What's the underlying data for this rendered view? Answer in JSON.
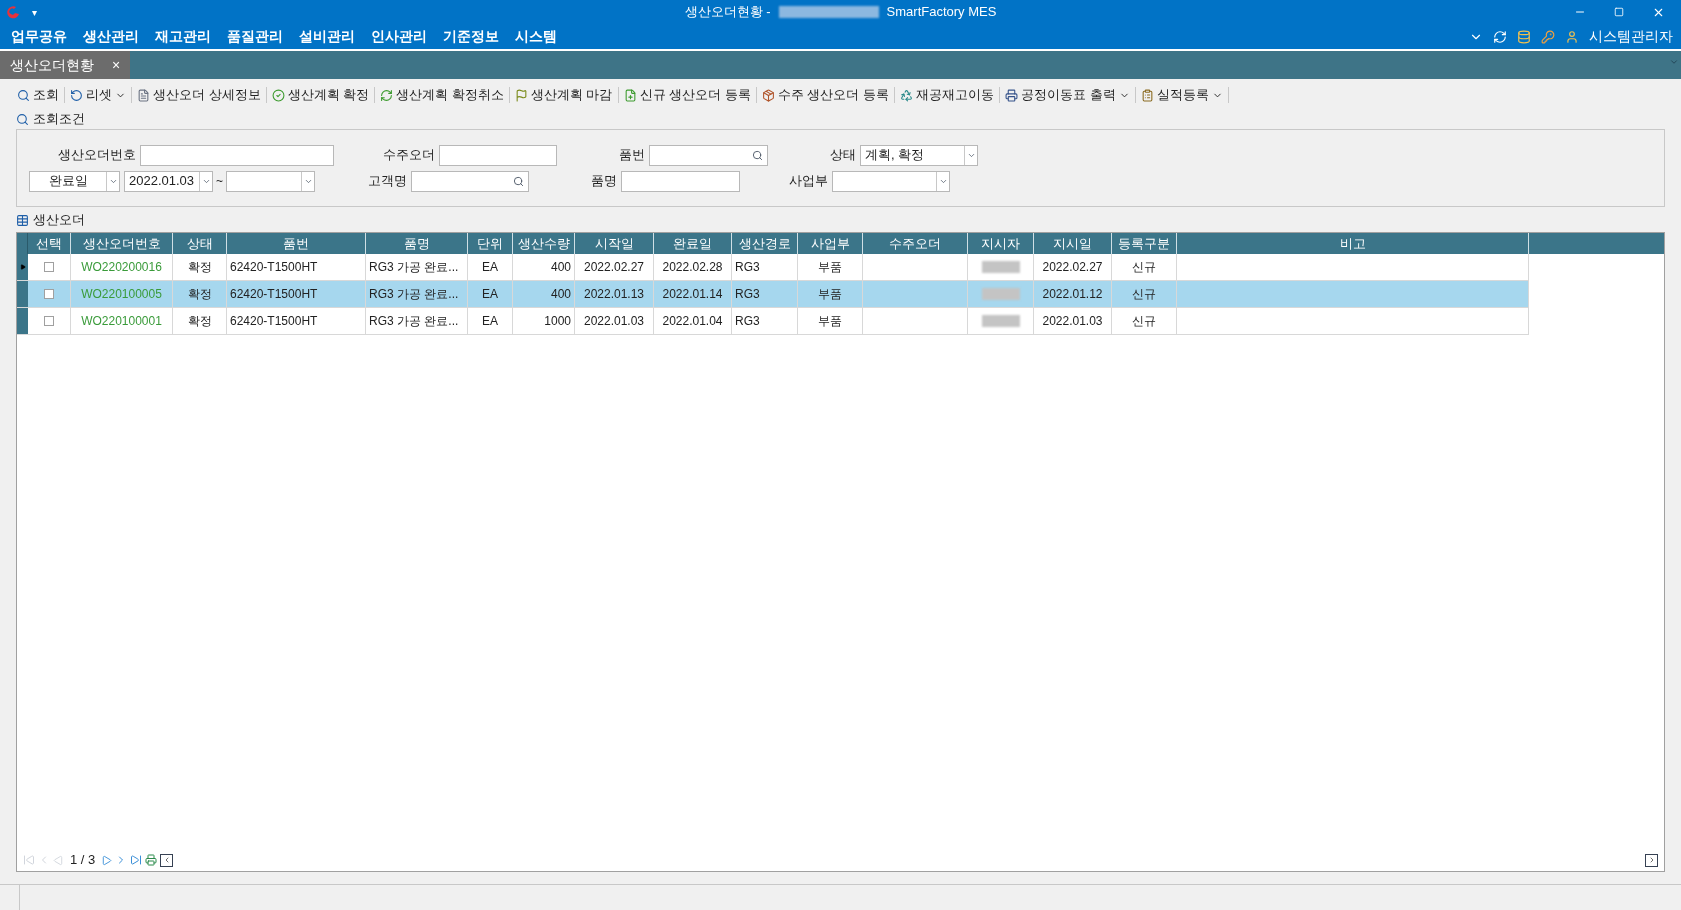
{
  "window": {
    "title_prefix": "생산오더현황 -",
    "title_suffix": "SmartFactory MES",
    "menu_glyph": "▾"
  },
  "menu": [
    "업무공유",
    "생산관리",
    "재고관리",
    "품질관리",
    "설비관리",
    "인사관리",
    "기준정보",
    "시스템"
  ],
  "user": {
    "name": "시스템관리자"
  },
  "tabs": [
    {
      "label": "생산오더현황",
      "selected": true,
      "close": "×"
    }
  ],
  "toolbar": [
    {
      "label": "조회",
      "dropdown": false
    },
    {
      "label": "리셋",
      "dropdown": true
    },
    {
      "label": "생산오더 상세정보",
      "dropdown": false
    },
    {
      "label": "생산계획 확정",
      "dropdown": false
    },
    {
      "label": "생산계획 확정취소",
      "dropdown": false
    },
    {
      "label": "생산계획 마감",
      "dropdown": false
    },
    {
      "label": "신규 생산오더 등록",
      "dropdown": false
    },
    {
      "label": "수주 생산오더 등록",
      "dropdown": false
    },
    {
      "label": "재공재고이동",
      "dropdown": false
    },
    {
      "label": "공정이동표 출력",
      "dropdown": true
    },
    {
      "label": "실적등록",
      "dropdown": true
    }
  ],
  "search": {
    "title": "조회조건",
    "fields": [
      {
        "label": "생산오더번호",
        "kind": "text"
      },
      {
        "label": "수주오더",
        "kind": "text"
      },
      {
        "label": "품번",
        "kind": "lookup"
      },
      {
        "label": "상태",
        "kind": "select",
        "value": "계획, 확정"
      },
      {
        "label": "완료일",
        "kind": "daterange",
        "value": "2022.01.03",
        "separator": "~"
      },
      {
        "label": "고객명",
        "kind": "lookup"
      },
      {
        "label": "품명",
        "kind": "text"
      },
      {
        "label": "사업부",
        "kind": "select"
      }
    ]
  },
  "grid": {
    "title": "생산오더",
    "columns": [
      "선택",
      "생산오더번호",
      "상태",
      "품번",
      "품명",
      "단위",
      "생산수량",
      "시작일",
      "완료일",
      "생산경로",
      "사업부",
      "수주오더",
      "지시자",
      "지시일",
      "등록구분",
      "비고"
    ],
    "rows": [
      {
        "current": true,
        "selected": false,
        "checked": false,
        "cells": [
          "",
          "WO220200016",
          "확정",
          "62420-T1500HT",
          "RG3 가공 완료...",
          "EA",
          "400",
          "2022.02.27",
          "2022.02.28",
          "RG3",
          "부품",
          "",
          "",
          "2022.02.27",
          "신규",
          ""
        ]
      },
      {
        "current": false,
        "selected": true,
        "checked": false,
        "cells": [
          "",
          "WO220100005",
          "확정",
          "62420-T1500HT",
          "RG3 가공 완료...",
          "EA",
          "400",
          "2022.01.13",
          "2022.01.14",
          "RG3",
          "부품",
          "",
          "",
          "2022.01.12",
          "신규",
          ""
        ]
      },
      {
        "current": false,
        "selected": false,
        "checked": false,
        "cells": [
          "",
          "WO220100001",
          "확정",
          "62420-T1500HT",
          "RG3 가공 완료...",
          "EA",
          "1000",
          "2022.01.03",
          "2022.01.04",
          "RG3",
          "부품",
          "",
          "",
          "2022.01.03",
          "신규",
          ""
        ]
      }
    ],
    "pager": "1 / 3"
  }
}
